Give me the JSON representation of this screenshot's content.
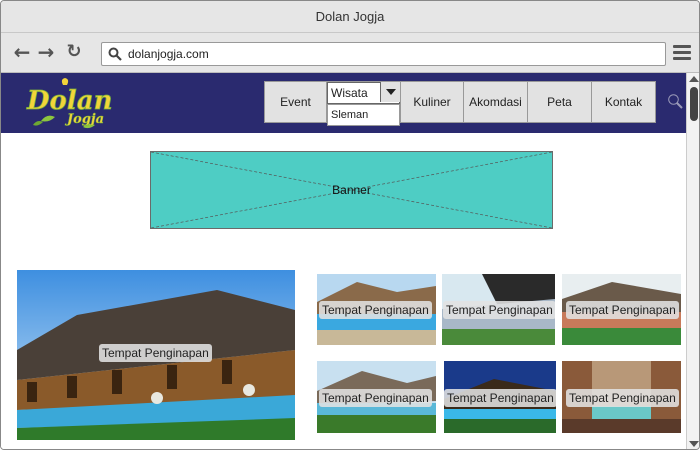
{
  "window": {
    "title": "Dolan Jogja"
  },
  "browser": {
    "back_icon": "arrow-left-icon",
    "forward_icon": "arrow-right-icon",
    "reload_icon": "reload-icon",
    "url": "dolanjogja.com",
    "menu_icon": "hamburger-icon"
  },
  "site": {
    "logo": {
      "main": "Dolan",
      "sub": "Jogja"
    },
    "nav": {
      "event": "Event",
      "wisata": {
        "selected": "Wisata",
        "options": [
          "Sleman"
        ]
      },
      "kuliner": "Kuliner",
      "akomodasi": "Akomdasi",
      "peta": "Peta",
      "kontak": "Kontak"
    },
    "search_icon": "search-icon",
    "banner": {
      "label": "Banner"
    },
    "featured": {
      "label": "Tempat Penginapan"
    },
    "grid": [
      {
        "label": "Tempat Penginapan"
      },
      {
        "label": "Tempat Penginapan"
      },
      {
        "label": "Tempat Penginapan"
      },
      {
        "label": "Tempat Penginapan"
      },
      {
        "label": "Tempat Penginapan"
      },
      {
        "label": "Tempat Penginapan"
      }
    ]
  },
  "colors": {
    "header_bg": "#2a2a6f",
    "banner_bg": "#4ecdc4",
    "logo_green": "#8cc63f",
    "logo_yellow": "#f2d43a"
  }
}
